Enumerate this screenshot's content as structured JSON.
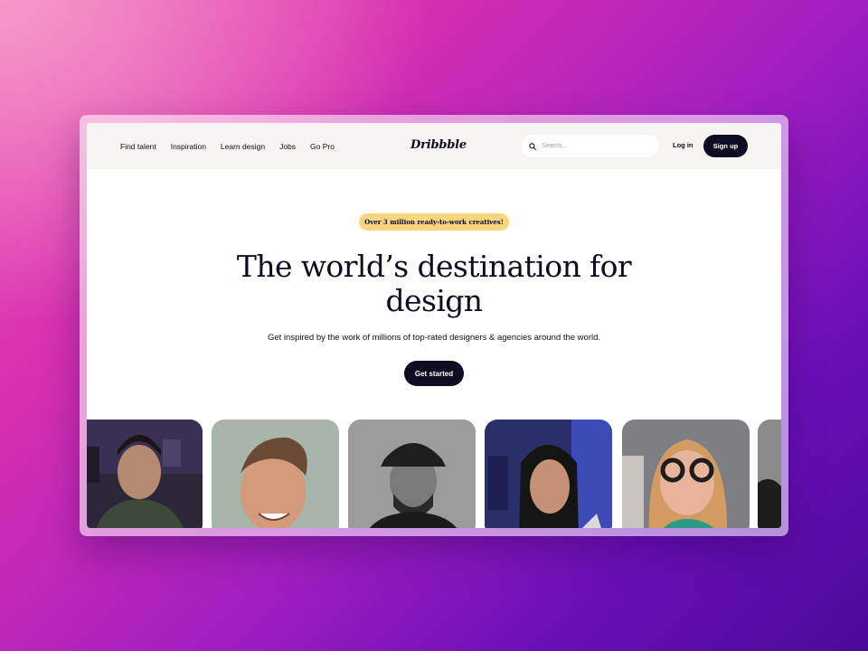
{
  "nav": {
    "links": [
      "Find talent",
      "Inspiration",
      "Learn design",
      "Jobs",
      "Go Pro"
    ],
    "logo": "Dribbble",
    "search_placeholder": "Search...",
    "login_label": "Log in",
    "signup_label": "Sign up"
  },
  "hero": {
    "badge": "Over 3 million ready-to-work creatives!",
    "headline_line1": "The world’s destination for",
    "headline_line2": "design",
    "subtitle": "Get inspired by the work of millions of top-rated designers & agencies around the world.",
    "cta_label": "Get started"
  },
  "colors": {
    "ink": "#0d0c22",
    "badge": "#f8d57e",
    "nav_bg": "#f7f5f1"
  },
  "cards": [
    {
      "name": "designer-video-card-1"
    },
    {
      "name": "designer-video-card-2"
    },
    {
      "name": "designer-video-card-3"
    },
    {
      "name": "designer-video-card-4"
    },
    {
      "name": "designer-video-card-5"
    },
    {
      "name": "designer-video-card-6"
    }
  ]
}
